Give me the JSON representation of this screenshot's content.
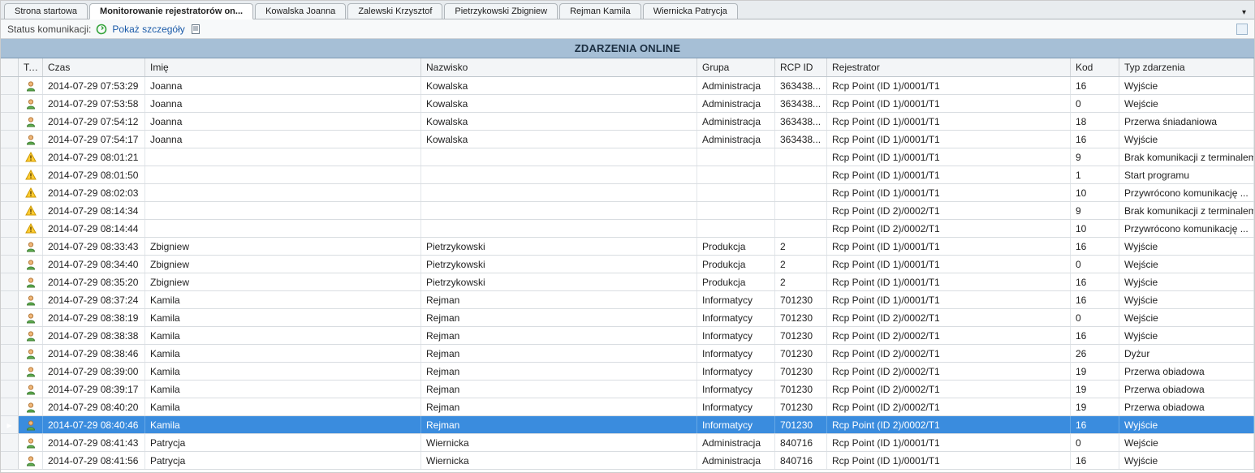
{
  "tabs": [
    {
      "label": "Strona startowa",
      "active": false
    },
    {
      "label": "Monitorowanie rejestratorów on...",
      "active": true
    },
    {
      "label": "Kowalska Joanna",
      "active": false
    },
    {
      "label": "Zalewski Krzysztof",
      "active": false
    },
    {
      "label": "Pietrzykowski Zbigniew",
      "active": false
    },
    {
      "label": "Rejman Kamila",
      "active": false
    },
    {
      "label": "Wiernicka Patrycja",
      "active": false
    }
  ],
  "status": {
    "label": "Status komunikacji:",
    "details_link": "Pokaż szczegóły"
  },
  "banner": "ZDARZENIA ONLINE",
  "columns": {
    "tag": "Tag",
    "czas": "Czas",
    "imie": "Imię",
    "nazwisko": "Nazwisko",
    "grupa": "Grupa",
    "rcp_id": "RCP ID",
    "rejestrator": "Rejestrator",
    "kod": "Kod",
    "typ": "Typ zdarzenia"
  },
  "rows": [
    {
      "icon": "person",
      "czas": "2014-07-29 07:53:29",
      "imie": "Joanna",
      "nazw": "Kowalska",
      "grupa": "Administracja",
      "rcp": "363438...",
      "rej": "Rcp Point (ID 1)/0001/T1",
      "kod": "16",
      "typ": "Wyjście",
      "selected": false
    },
    {
      "icon": "person",
      "czas": "2014-07-29 07:53:58",
      "imie": "Joanna",
      "nazw": "Kowalska",
      "grupa": "Administracja",
      "rcp": "363438...",
      "rej": "Rcp Point (ID 1)/0001/T1",
      "kod": "0",
      "typ": "Wejście",
      "selected": false
    },
    {
      "icon": "person",
      "czas": "2014-07-29 07:54:12",
      "imie": "Joanna",
      "nazw": "Kowalska",
      "grupa": "Administracja",
      "rcp": "363438...",
      "rej": "Rcp Point (ID 1)/0001/T1",
      "kod": "18",
      "typ": "Przerwa śniadaniowa",
      "selected": false
    },
    {
      "icon": "person",
      "czas": "2014-07-29 07:54:17",
      "imie": "Joanna",
      "nazw": "Kowalska",
      "grupa": "Administracja",
      "rcp": "363438...",
      "rej": "Rcp Point (ID 1)/0001/T1",
      "kod": "16",
      "typ": "Wyjście",
      "selected": false
    },
    {
      "icon": "warn",
      "czas": "2014-07-29 08:01:21",
      "imie": "",
      "nazw": "",
      "grupa": "",
      "rcp": "",
      "rej": "Rcp Point (ID 1)/0001/T1",
      "kod": "9",
      "typ": "Brak komunikacji z terminalem",
      "selected": false
    },
    {
      "icon": "warn",
      "czas": "2014-07-29 08:01:50",
      "imie": "",
      "nazw": "",
      "grupa": "",
      "rcp": "",
      "rej": "Rcp Point (ID 1)/0001/T1",
      "kod": "1",
      "typ": "Start programu",
      "selected": false
    },
    {
      "icon": "warn",
      "czas": "2014-07-29 08:02:03",
      "imie": "",
      "nazw": "",
      "grupa": "",
      "rcp": "",
      "rej": "Rcp Point (ID 1)/0001/T1",
      "kod": "10",
      "typ": "Przywrócono komunikację ...",
      "selected": false
    },
    {
      "icon": "warn",
      "czas": "2014-07-29 08:14:34",
      "imie": "",
      "nazw": "",
      "grupa": "",
      "rcp": "",
      "rej": "Rcp Point (ID 2)/0002/T1",
      "kod": "9",
      "typ": "Brak komunikacji z terminalem",
      "selected": false
    },
    {
      "icon": "warn",
      "czas": "2014-07-29 08:14:44",
      "imie": "",
      "nazw": "",
      "grupa": "",
      "rcp": "",
      "rej": "Rcp Point (ID 2)/0002/T1",
      "kod": "10",
      "typ": "Przywrócono komunikację ...",
      "selected": false
    },
    {
      "icon": "person",
      "czas": "2014-07-29 08:33:43",
      "imie": "Zbigniew",
      "nazw": "Pietrzykowski",
      "grupa": "Produkcja",
      "rcp": "2",
      "rej": "Rcp Point (ID 1)/0001/T1",
      "kod": "16",
      "typ": "Wyjście",
      "selected": false
    },
    {
      "icon": "person",
      "czas": "2014-07-29 08:34:40",
      "imie": "Zbigniew",
      "nazw": "Pietrzykowski",
      "grupa": "Produkcja",
      "rcp": "2",
      "rej": "Rcp Point (ID 1)/0001/T1",
      "kod": "0",
      "typ": "Wejście",
      "selected": false
    },
    {
      "icon": "person",
      "czas": "2014-07-29 08:35:20",
      "imie": "Zbigniew",
      "nazw": "Pietrzykowski",
      "grupa": "Produkcja",
      "rcp": "2",
      "rej": "Rcp Point (ID 1)/0001/T1",
      "kod": "16",
      "typ": "Wyjście",
      "selected": false
    },
    {
      "icon": "person",
      "czas": "2014-07-29 08:37:24",
      "imie": "Kamila",
      "nazw": "Rejman",
      "grupa": "Informatycy",
      "rcp": "701230",
      "rej": "Rcp Point (ID 1)/0001/T1",
      "kod": "16",
      "typ": "Wyjście",
      "selected": false
    },
    {
      "icon": "person",
      "czas": "2014-07-29 08:38:19",
      "imie": "Kamila",
      "nazw": "Rejman",
      "grupa": "Informatycy",
      "rcp": "701230",
      "rej": "Rcp Point (ID 2)/0002/T1",
      "kod": "0",
      "typ": "Wejście",
      "selected": false
    },
    {
      "icon": "person",
      "czas": "2014-07-29 08:38:38",
      "imie": "Kamila",
      "nazw": "Rejman",
      "grupa": "Informatycy",
      "rcp": "701230",
      "rej": "Rcp Point (ID 2)/0002/T1",
      "kod": "16",
      "typ": "Wyjście",
      "selected": false
    },
    {
      "icon": "person",
      "czas": "2014-07-29 08:38:46",
      "imie": "Kamila",
      "nazw": "Rejman",
      "grupa": "Informatycy",
      "rcp": "701230",
      "rej": "Rcp Point (ID 2)/0002/T1",
      "kod": "26",
      "typ": "Dyżur",
      "selected": false
    },
    {
      "icon": "person",
      "czas": "2014-07-29 08:39:00",
      "imie": "Kamila",
      "nazw": "Rejman",
      "grupa": "Informatycy",
      "rcp": "701230",
      "rej": "Rcp Point (ID 2)/0002/T1",
      "kod": "19",
      "typ": "Przerwa obiadowa",
      "selected": false
    },
    {
      "icon": "person",
      "czas": "2014-07-29 08:39:17",
      "imie": "Kamila",
      "nazw": "Rejman",
      "grupa": "Informatycy",
      "rcp": "701230",
      "rej": "Rcp Point (ID 2)/0002/T1",
      "kod": "19",
      "typ": "Przerwa obiadowa",
      "selected": false
    },
    {
      "icon": "person",
      "czas": "2014-07-29 08:40:20",
      "imie": "Kamila",
      "nazw": "Rejman",
      "grupa": "Informatycy",
      "rcp": "701230",
      "rej": "Rcp Point (ID 2)/0002/T1",
      "kod": "19",
      "typ": "Przerwa obiadowa",
      "selected": false
    },
    {
      "icon": "person",
      "czas": "2014-07-29 08:40:46",
      "imie": "Kamila",
      "nazw": "Rejman",
      "grupa": "Informatycy",
      "rcp": "701230",
      "rej": "Rcp Point (ID 2)/0002/T1",
      "kod": "16",
      "typ": "Wyjście",
      "selected": true
    },
    {
      "icon": "person",
      "czas": "2014-07-29 08:41:43",
      "imie": "Patrycja",
      "nazw": "Wiernicka",
      "grupa": "Administracja",
      "rcp": "840716",
      "rej": "Rcp Point (ID 1)/0001/T1",
      "kod": "0",
      "typ": "Wejście",
      "selected": false
    },
    {
      "icon": "person",
      "czas": "2014-07-29 08:41:56",
      "imie": "Patrycja",
      "nazw": "Wiernicka",
      "grupa": "Administracja",
      "rcp": "840716",
      "rej": "Rcp Point (ID 1)/0001/T1",
      "kod": "16",
      "typ": "Wyjście",
      "selected": false
    }
  ]
}
